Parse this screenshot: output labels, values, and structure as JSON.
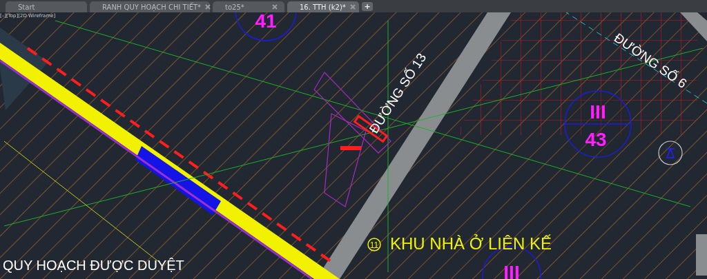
{
  "tabs": [
    {
      "label": "Start",
      "selected": false,
      "closable": false
    },
    {
      "label": "RANH QUY HOẠCH CHI TIẾT*",
      "selected": false,
      "closable": true
    },
    {
      "label": "to25*",
      "selected": false,
      "closable": true
    },
    {
      "label": "16. TTH (k2)*",
      "selected": true,
      "closable": true
    }
  ],
  "new_tab": "+",
  "viewport_label": "[–][Top][2D Wireframe]",
  "drawing": {
    "block_top_number": "41",
    "road_13": "ĐƯỜNG SỐ 13",
    "road_6": "ĐƯỜNG SỐ 6",
    "block_right_zone": "III",
    "block_right_number": "43",
    "area_marker": "11",
    "area_name": "KHU NHÀ Ở LIÊN KẾ",
    "block_bottom_zone": "III",
    "plan_title": "QUY HOẠCH  ĐƯỢC DUYỆT"
  }
}
